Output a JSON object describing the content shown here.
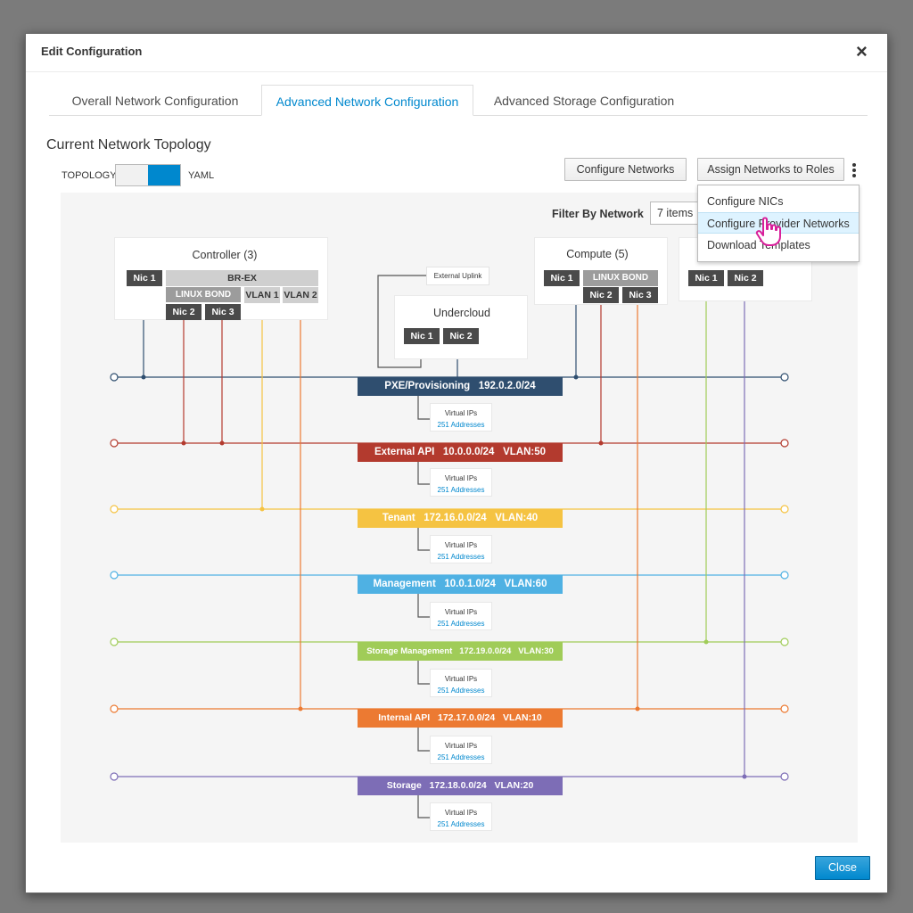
{
  "modal": {
    "title": "Edit Configuration",
    "close_icon": "×"
  },
  "tabs": [
    {
      "label": "Overall Network Configuration"
    },
    {
      "label": "Advanced Network Configuration"
    },
    {
      "label": "Advanced Storage Configuration"
    }
  ],
  "section": {
    "title": "Current Network Topology"
  },
  "toggle": {
    "left_label": "TOPOLOGY",
    "right_label": "YAML",
    "state": "on"
  },
  "toolbar": {
    "configure_networks": "Configure Networks",
    "assign_networks": "Assign Networks to Roles"
  },
  "dropdown": {
    "items": [
      "Configure NICs",
      "Configure Provider Networks",
      "Download Templates"
    ],
    "hovered": "Configure Provider Networks"
  },
  "filter": {
    "label": "Filter By Network",
    "value": "7 items"
  },
  "nodes": {
    "controller": {
      "title": "Controller (3)",
      "nic1": "Nic 1",
      "bridge": "BR-EX",
      "bond": "LINUX BOND",
      "nic2": "Nic 2",
      "nic3": "Nic 3",
      "vlan1": "VLAN 1",
      "vlan2": "VLAN 2"
    },
    "undercloud": {
      "title": "Undercloud",
      "nic1": "Nic 1",
      "nic2": "Nic 2",
      "uplink": "External Uplink"
    },
    "compute": {
      "title": "Compute (5)",
      "nic1": "Nic 1",
      "bond": "LINUX BOND",
      "nic2": "Nic 2",
      "nic3": "Nic 3"
    },
    "storage": {
      "nic1": "Nic 1",
      "nic2": "Nic 2"
    }
  },
  "networks": [
    {
      "name": "PXE/Provisioning",
      "cidr": "192.0.2.0/24",
      "vlan": "",
      "color": "#2f4e6f"
    },
    {
      "name": "External API",
      "cidr": "10.0.0.0/24",
      "vlan": "VLAN:50",
      "color": "#b33a2e"
    },
    {
      "name": "Tenant",
      "cidr": "172.16.0.0/24",
      "vlan": "VLAN:40",
      "color": "#f5c342"
    },
    {
      "name": "Management",
      "cidr": "10.0.1.0/24",
      "vlan": "VLAN:60",
      "color": "#4fb1e3"
    },
    {
      "name": "Storage Management",
      "cidr": "172.19.0.0/24",
      "vlan": "VLAN:30",
      "color": "#a0cc58"
    },
    {
      "name": "Internal API",
      "cidr": "172.17.0.0/24",
      "vlan": "VLAN:10",
      "color": "#ec7a32"
    },
    {
      "name": "Storage",
      "cidr": "172.18.0.0/24",
      "vlan": "VLAN:20",
      "color": "#7d6db6"
    }
  ],
  "virtual_ips": {
    "label": "Virtual IPs",
    "addresses": "251 Addresses"
  },
  "footer": {
    "close_label": "Close"
  }
}
